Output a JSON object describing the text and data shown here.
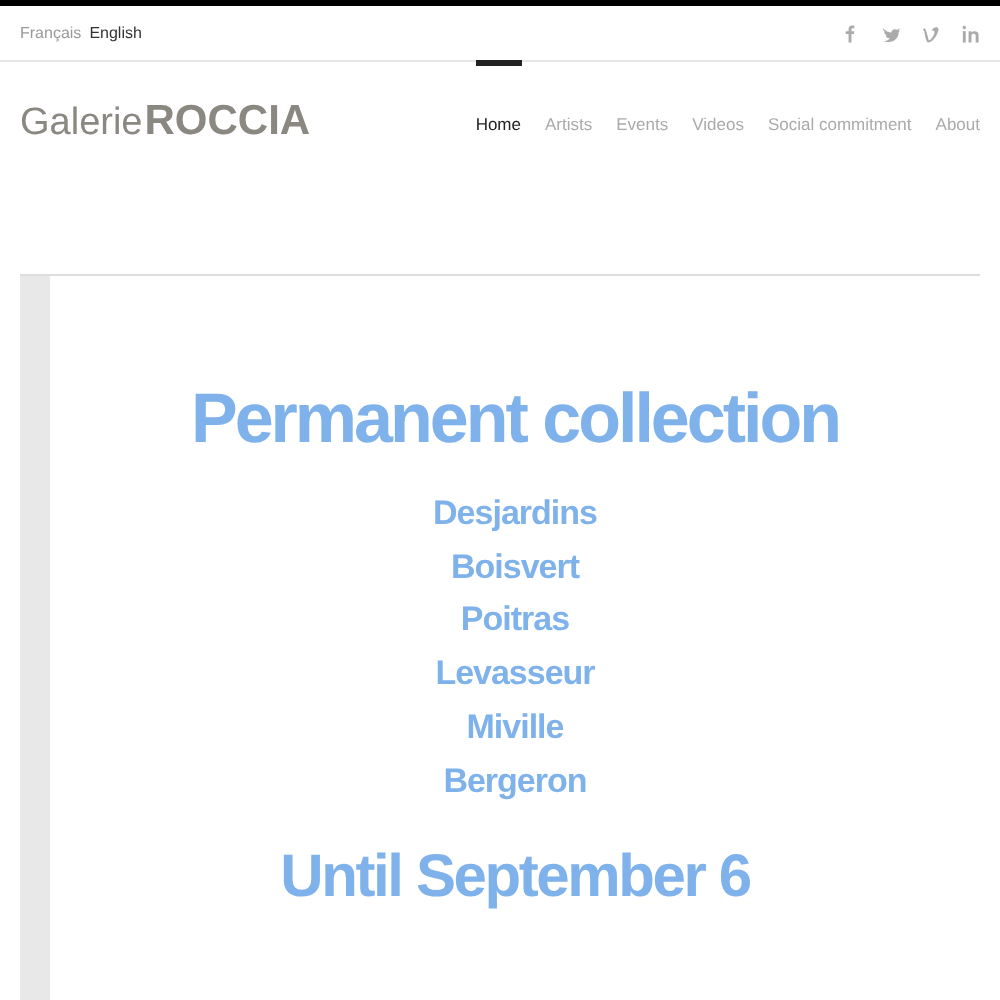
{
  "languages": [
    {
      "label": "Français",
      "selected": false
    },
    {
      "label": "English",
      "selected": true
    }
  ],
  "social": [
    {
      "kind": "facebook"
    },
    {
      "kind": "twitter"
    },
    {
      "kind": "vimeo"
    },
    {
      "kind": "linkedin"
    }
  ],
  "logo": {
    "prefix": "Galerie",
    "name": "ROCCIA"
  },
  "nav": [
    {
      "label": "Home",
      "selected": true
    },
    {
      "label": "Artists",
      "selected": false
    },
    {
      "label": "Events",
      "selected": false
    },
    {
      "label": "Videos",
      "selected": false
    },
    {
      "label": "Social commitment",
      "selected": false
    },
    {
      "label": "About",
      "selected": false
    }
  ],
  "content": {
    "title": "Permanent collection",
    "artists": [
      "Desjardins",
      "Boisvert",
      "Poitras",
      "Levasseur",
      "Miville",
      "Bergeron"
    ],
    "footer": "Until September 6"
  }
}
